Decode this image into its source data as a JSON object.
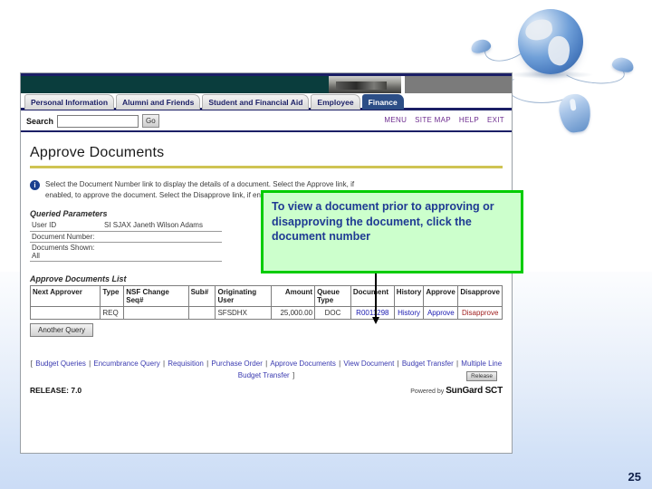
{
  "slide": {
    "number": "25",
    "decorative_art": "globe-and-mice-graphic"
  },
  "app": {
    "tabs": [
      {
        "label": "Personal Information",
        "active": false
      },
      {
        "label": "Alumni and Friends",
        "active": false
      },
      {
        "label": "Student and Financial Aid",
        "active": false
      },
      {
        "label": "Employee",
        "active": false
      },
      {
        "label": "Finance",
        "active": true
      }
    ],
    "search": {
      "label": "Search",
      "value": "",
      "placeholder": "",
      "go_label": "Go"
    },
    "nav_links": [
      "MENU",
      "SITE MAP",
      "HELP",
      "EXIT"
    ],
    "page_title": "Approve Documents",
    "info": {
      "icon": "info-icon",
      "text": "Select the Document Number link to display the details of a document. Select the Approve link, if enabled, to approve the document. Select the Disapprove link, if enabled, to disapprove the document."
    },
    "queried_parameters": {
      "heading": "Queried Parameters",
      "rows": [
        {
          "key": "User ID",
          "value": "SI SJAX Janeth Wilson Adams"
        },
        {
          "key": "Document Number:",
          "value": ""
        },
        {
          "key": "Documents Shown: All",
          "value": ""
        }
      ]
    },
    "documents_list": {
      "heading": "Approve Documents List",
      "columns": [
        "Next Approver",
        "Type",
        "NSF Change Seq#",
        "Sub#",
        "Originating User",
        "Amount",
        "Queue Type",
        "Document",
        "History",
        "Approve",
        "Disapprove"
      ],
      "rows": [
        {
          "next_approver": "",
          "type": "REQ",
          "nsf_change_seq": "",
          "sub": "",
          "originating_user": "SFSDHX",
          "amount": "25,000.00",
          "queue_type": "DOC",
          "document": "R0011298",
          "history": "History",
          "approve": "Approve",
          "disapprove": "Disapprove"
        }
      ]
    },
    "another_query_label": "Another Query",
    "footer": {
      "open_bracket": "[",
      "close_bracket": "]",
      "links": [
        "Budget Queries",
        "Encumbrance Query",
        "Requisition",
        "Purchase Order",
        "Approve Documents",
        "View Document",
        "Budget Transfer",
        "Multiple Line Budget Transfer"
      ],
      "release": "RELEASE: 7.0",
      "powered_prefix": "Powered by",
      "powered_brand": "SunGard SCT",
      "release_button": "Release"
    }
  },
  "callout": {
    "text": "To view a document prior to approving or disapproving the document, click the document number",
    "fill_color": "#ccffcc",
    "border_color": "#00cc00",
    "text_color": "#1f3a93"
  }
}
